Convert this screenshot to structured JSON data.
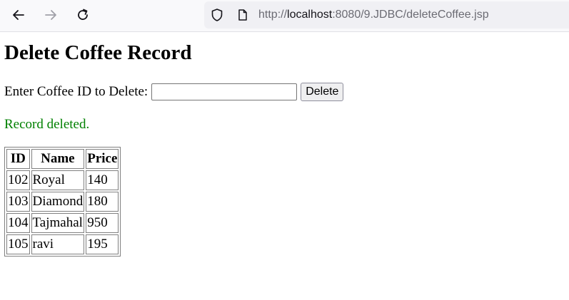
{
  "browser": {
    "url_prefix": "http://",
    "url_host": "localhost",
    "url_rest": ":8080/9.JDBC/deleteCoffee.jsp",
    "back_icon": "arrow-left-icon",
    "forward_icon": "arrow-right-icon",
    "reload_icon": "reload-icon",
    "shield_icon": "shield-icon",
    "page_icon": "page-icon"
  },
  "page": {
    "title": "Delete Coffee Record",
    "form": {
      "label": "Enter Coffee ID to Delete:",
      "input_value": "",
      "button_label": "Delete"
    },
    "status_message": "Record deleted.",
    "status_color": "#008000",
    "table": {
      "headers": [
        "ID",
        "Name",
        "Price"
      ],
      "rows": [
        [
          "102",
          "Royal",
          "140"
        ],
        [
          "103",
          "Diamond",
          "180"
        ],
        [
          "104",
          "Tajmahal",
          "950"
        ],
        [
          "105",
          "ravi",
          "195"
        ]
      ]
    }
  }
}
